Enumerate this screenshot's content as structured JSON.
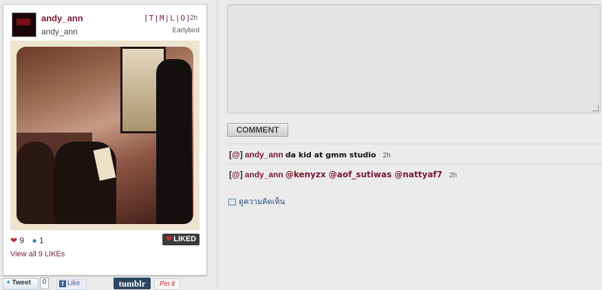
{
  "post": {
    "username": "andy_ann",
    "fullname": "andy_ann",
    "tmlo": "[T|M|L|O]",
    "time": "2h",
    "filter": "Earlybird",
    "likes": "9",
    "comments": "1",
    "liked_label": "LIKED",
    "view_all": "View all 9 LIKEs"
  },
  "share": {
    "tweet_label": "Tweet",
    "tweet_count": "0",
    "fb_label": "Like",
    "tumblr_label": "tumblr",
    "pin_label": "Pin it"
  },
  "comment_form": {
    "button_label": "COMMENT"
  },
  "comments": [
    {
      "bracket_open": "[",
      "at": "@",
      "bracket_close": "]",
      "user": "andy_ann",
      "text": "da kid at gmm studio",
      "time": "2h"
    },
    {
      "bracket_open": "[",
      "at": "@",
      "bracket_close": "]",
      "user": "andy_ann",
      "text": "@kenyzx @aof_sutiwas @nattyaf7",
      "time": "2h"
    }
  ],
  "view_comments_label": "ดูความคิดเห็น",
  "icons": {
    "heart": "heart-icon",
    "bubble": "comment-bubble-icon",
    "twitter": "twitter-bird-icon",
    "facebook": "facebook-icon",
    "comments": "comments-icon"
  }
}
